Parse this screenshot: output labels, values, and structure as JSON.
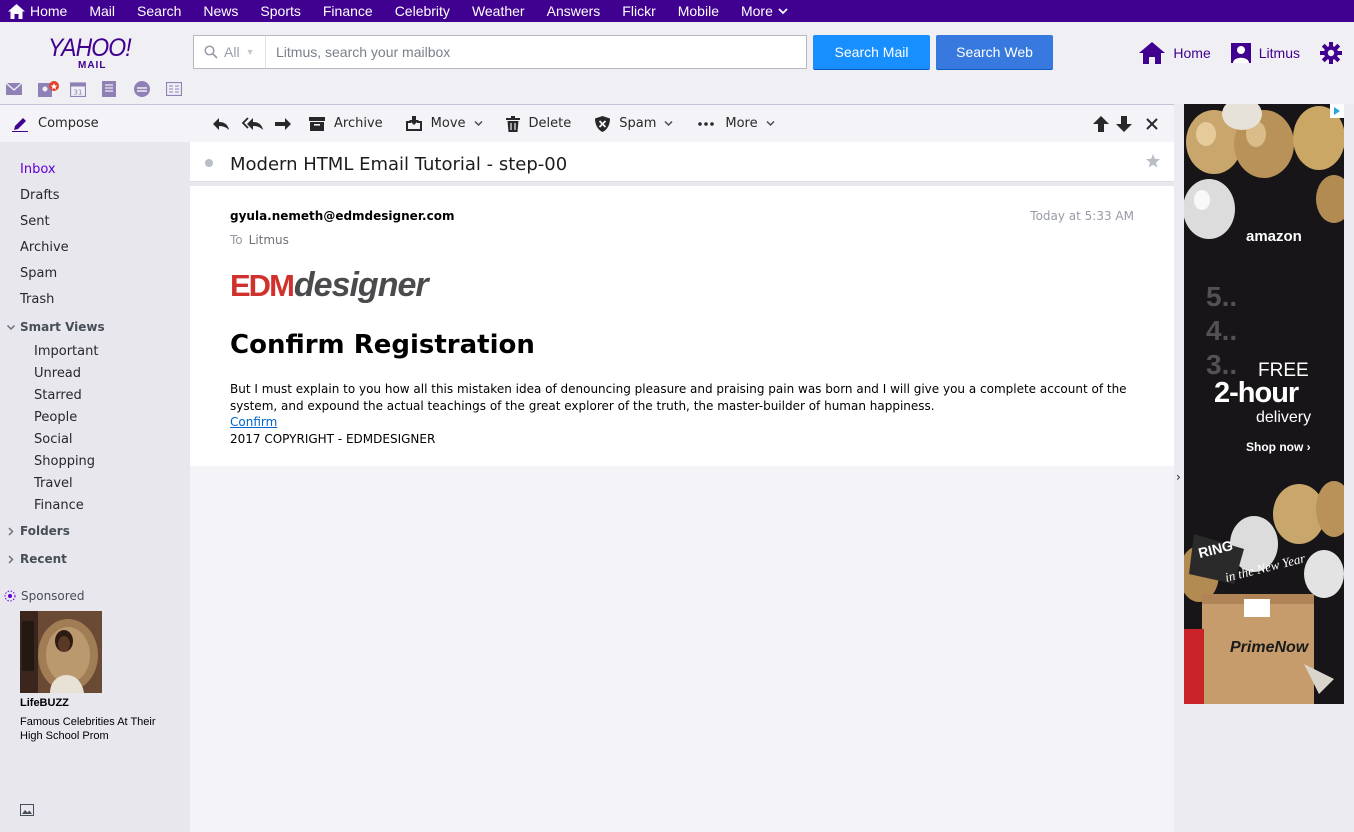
{
  "topnav": {
    "items": [
      "Home",
      "Mail",
      "Search",
      "News",
      "Sports",
      "Finance",
      "Celebrity",
      "Weather",
      "Answers",
      "Flickr",
      "Mobile",
      "More"
    ]
  },
  "logo": {
    "brand": "YAHOO!",
    "sub": "MAIL"
  },
  "search": {
    "scope": "All",
    "placeholder": "Litmus, search your mailbox",
    "search_mail_label": "Search Mail",
    "search_web_label": "Search Web"
  },
  "header_right": {
    "home_label": "Home",
    "user_label": "Litmus"
  },
  "sidebar": {
    "compose_label": "Compose",
    "folders": [
      "Inbox",
      "Drafts",
      "Sent",
      "Archive",
      "Spam",
      "Trash"
    ],
    "smart_views_label": "Smart Views",
    "smart_views": [
      "Important",
      "Unread",
      "Starred",
      "People",
      "Social",
      "Shopping",
      "Travel",
      "Finance"
    ],
    "folders_label": "Folders",
    "recent_label": "Recent",
    "sponsored_label": "Sponsored",
    "sponsor_source": "LifeBUZZ",
    "sponsor_title": "Famous Celebrities At Their High School Prom"
  },
  "toolbar": {
    "archive_label": "Archive",
    "move_label": "Move",
    "delete_label": "Delete",
    "spam_label": "Spam",
    "more_label": "More"
  },
  "message": {
    "subject": "Modern HTML Email Tutorial - step-00",
    "from": "gyula.nemeth@edmdesigner.com",
    "date": "Today at 5:33 AM",
    "to_prefix": "To",
    "to_name": "Litmus",
    "logo_edm": "EDM",
    "logo_designer": "designer",
    "heading": "Confirm Registration",
    "body": "But I must explain to you how all this mistaken idea of denouncing pleasure and praising pain was born and I will give you a complete account of the system, and expound the actual teachings of the great explorer of the truth, the master-builder of human happiness.",
    "confirm_link": "Confirm",
    "copyright": "2017 COPYRIGHT - EDMDESIGNER"
  },
  "ad": {
    "brand": "amazon",
    "countdown": "5..\n4..\n3..",
    "free": "FREE",
    "two_hour": "2-hour",
    "delivery": "delivery",
    "shop_now": "Shop now ›",
    "ring": "RING",
    "new_year": "in the New Year",
    "prime_now": "PrimeNow"
  },
  "colors": {
    "brand_purple": "#400090",
    "accent_blue": "#188fff",
    "active_folder": "#6001d2"
  }
}
